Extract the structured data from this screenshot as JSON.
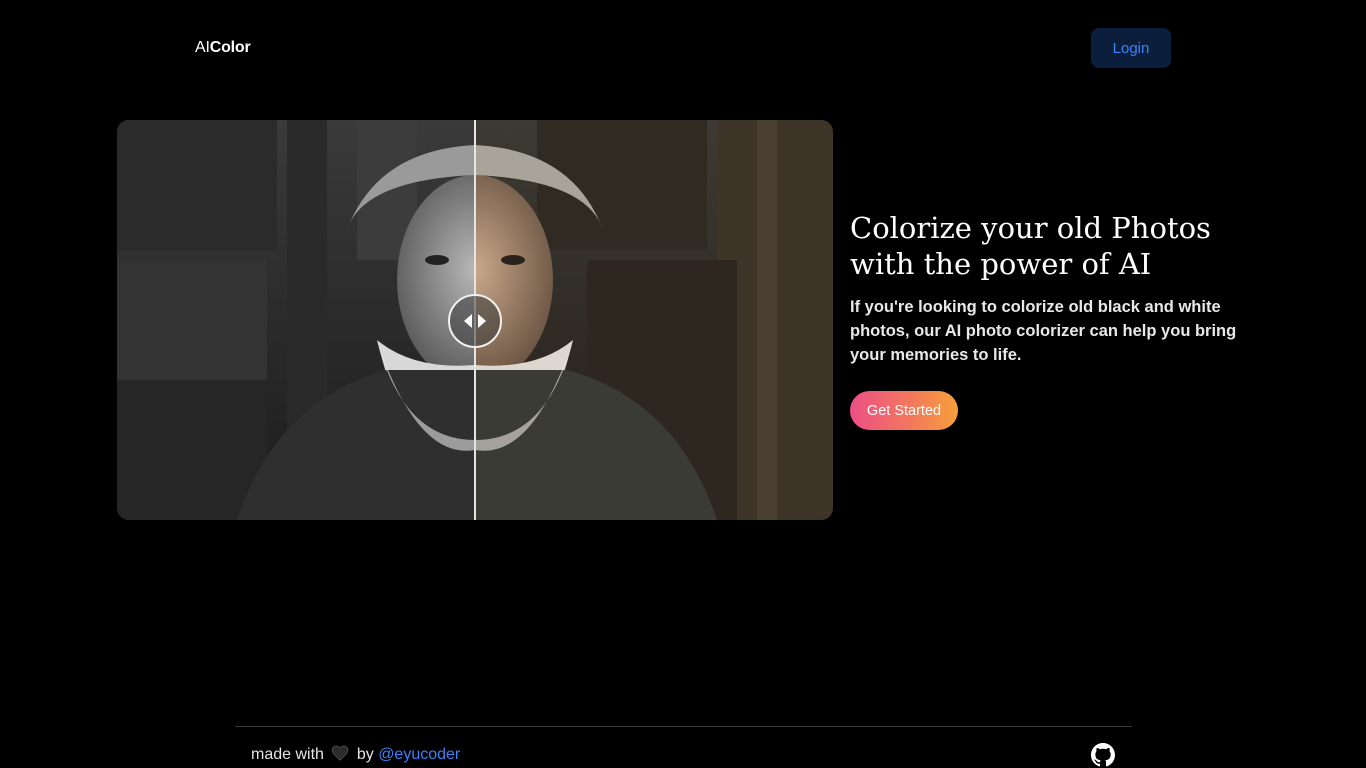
{
  "header": {
    "logo_prefix": "AI",
    "logo_strong": "Color",
    "login_label": "Login"
  },
  "hero": {
    "title_line1": "Colorize your old Photos",
    "title_line2": "with the power of AI",
    "description": "If you're looking to colorize old black and white photos, our AI photo colorizer can help you bring your memories to life.",
    "cta_label": "Get Started"
  },
  "comparison": {
    "icon": "compare-arrows-icon"
  },
  "footer": {
    "made_with": "made with",
    "by": "by",
    "author_link": "@eyucoder",
    "github_icon": "github-icon"
  },
  "colors": {
    "background": "#000000",
    "accent_blue": "#3b82f6",
    "login_bg": "#0b1f3d",
    "cta_gradient_start": "#ec4f86",
    "cta_gradient_end": "#f5a03a"
  }
}
